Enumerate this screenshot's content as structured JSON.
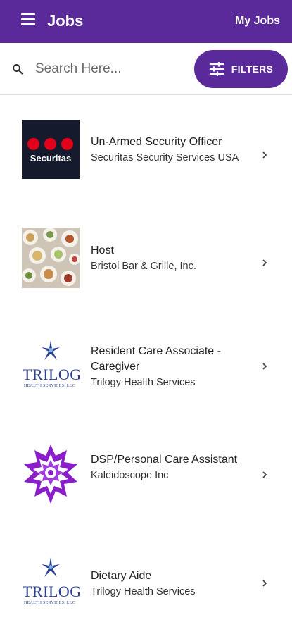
{
  "appbar": {
    "title": "Jobs",
    "my_jobs_label": "My Jobs",
    "background_color": "#5b2a9a",
    "menu_icon": "hamburger-menu-icon"
  },
  "search": {
    "placeholder": "Search Here...",
    "value": "",
    "icon": "search-icon"
  },
  "filters": {
    "label": "FILTERS",
    "icon": "sliders-icon"
  },
  "jobs": [
    {
      "title": "Un-Armed Security Officer",
      "company": "Securitas Security Services USA",
      "logo": "securitas-logo",
      "logo_text": "Securitas"
    },
    {
      "title": "Host",
      "company": "Bristol Bar & Grille, Inc.",
      "logo": "food-photo-logo"
    },
    {
      "title": "Resident Care Associate - Caregiver",
      "company": "Trilogy Health Services",
      "logo": "trilogy-logo",
      "logo_text": "TRILOGY",
      "logo_subtext": "HEALTH SERVICES, LLC"
    },
    {
      "title": "DSP/Personal Care Assistant",
      "company": "Kaleidoscope Inc",
      "logo": "kaleidoscope-logo"
    },
    {
      "title": "Dietary Aide",
      "company": "Trilogy Health Services",
      "logo": "trilogy-logo",
      "logo_text": "TRILOGY",
      "logo_subtext": "HEALTH SERVICES, LLC"
    }
  ]
}
